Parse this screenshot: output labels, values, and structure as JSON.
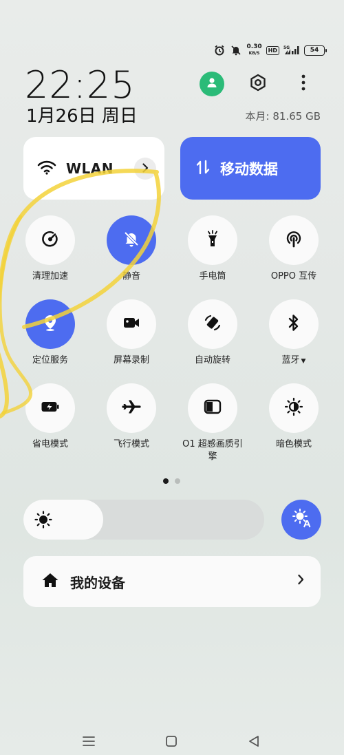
{
  "status_bar": {
    "speed_value": "0.30",
    "speed_unit": "KB/S",
    "hd": "HD",
    "network": "5G",
    "battery": "54"
  },
  "clock": {
    "time": "22:25",
    "date": "1月26日 周日"
  },
  "data_usage": "本月: 81.65 GB",
  "wlan": {
    "label": "WLAN"
  },
  "mobile_data": {
    "label": "移动数据"
  },
  "toggles": [
    {
      "label": "清理加速",
      "on": false,
      "icon": "cleanup-gauge-icon"
    },
    {
      "label": "静音",
      "on": true,
      "icon": "bell-off-icon"
    },
    {
      "label": "手电筒",
      "on": false,
      "icon": "flashlight-icon"
    },
    {
      "label": "OPPO 互传",
      "on": false,
      "icon": "share-antenna-icon"
    },
    {
      "label": "定位服务",
      "on": true,
      "icon": "location-pin-icon"
    },
    {
      "label": "屏幕录制",
      "on": false,
      "icon": "video-camera-icon"
    },
    {
      "label": "自动旋转",
      "on": false,
      "icon": "rotate-icon"
    },
    {
      "label": "蓝牙",
      "on": false,
      "icon": "bluetooth-icon"
    },
    {
      "label": "省电模式",
      "on": false,
      "icon": "battery-saver-icon"
    },
    {
      "label": "飞行模式",
      "on": false,
      "icon": "airplane-icon"
    },
    {
      "label": "O1 超感画质引擎",
      "on": false,
      "icon": "display-engine-icon"
    },
    {
      "label": "暗色模式",
      "on": false,
      "icon": "dark-mode-icon"
    }
  ],
  "page_indicator": {
    "current": 1,
    "total": 2
  },
  "brightness": {
    "level": 0.33
  },
  "my_devices": {
    "label": "我的设备"
  },
  "colors": {
    "accent": "#4d6cf0",
    "avatar_green": "#2bbb78",
    "tile_bg": "#fafafa",
    "marker_yellow": "#f3d23a"
  }
}
